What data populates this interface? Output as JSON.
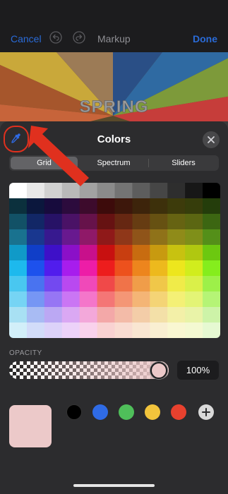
{
  "nav": {
    "cancel_label": "Cancel",
    "title": "Markup",
    "done_label": "Done",
    "undo_icon": "undo-icon",
    "redo_icon": "redo-icon"
  },
  "background": {
    "image_text": "SPRING",
    "colors": [
      "#d6a830",
      "#b24a33",
      "#2c5f98",
      "#6b8b3a"
    ]
  },
  "sheet": {
    "title": "Colors",
    "eyedropper_icon": "eyedropper-icon",
    "close_icon": "close-icon",
    "tabs": [
      {
        "label": "Grid",
        "selected": true
      },
      {
        "label": "Spectrum",
        "selected": false
      },
      {
        "label": "Sliders",
        "selected": false
      }
    ],
    "opacity_label": "OPACITY",
    "opacity_value": "100%",
    "selected_color": "#ecc9c9",
    "favorite_colors": [
      "#000000",
      "#2f6be5",
      "#4fbf5a",
      "#f2c43c",
      "#e8412e"
    ],
    "add_icon": "plus-icon"
  },
  "colors": {
    "accent": "#2a6bd8",
    "annotation": "#e0301e"
  }
}
